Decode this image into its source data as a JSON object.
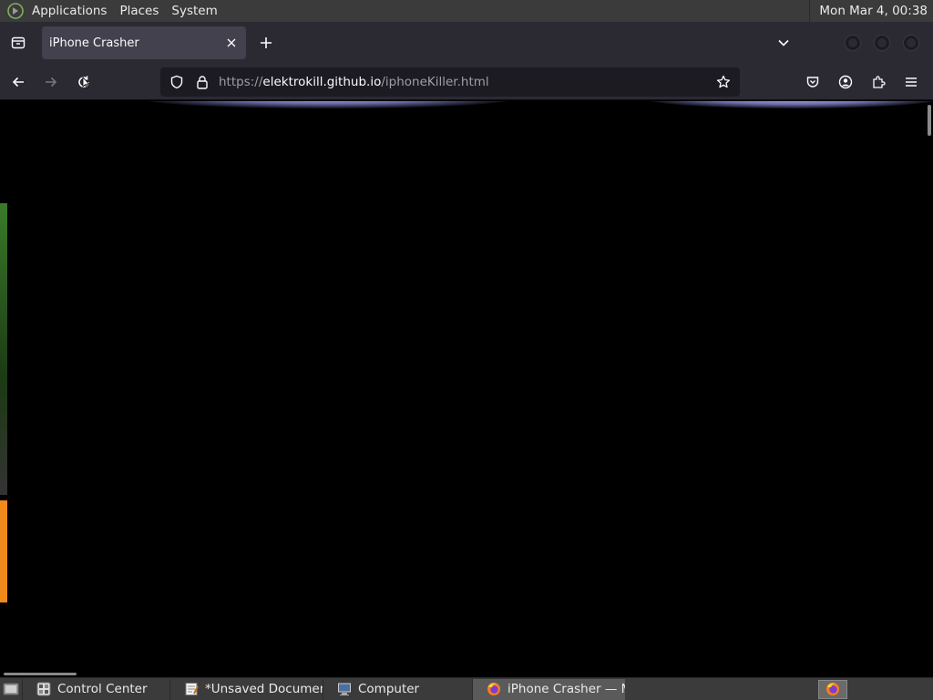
{
  "top_panel": {
    "menus": [
      "Applications",
      "Places",
      "System"
    ],
    "clock": "Mon Mar  4, 00:38"
  },
  "browser": {
    "tab": {
      "title": "iPhone Crasher"
    },
    "url": {
      "scheme": "https://",
      "host": "elektrokill.github.io",
      "path": "/iphoneKiller.html"
    }
  },
  "taskbar": {
    "tasks": [
      {
        "label": "Control Center",
        "icon": "control-center-icon"
      },
      {
        "label": "*Unsaved Documen…",
        "icon": "text-editor-icon"
      },
      {
        "label": "Computer",
        "icon": "computer-icon"
      },
      {
        "label": "iPhone Crasher — M…",
        "icon": "firefox-icon",
        "active": true
      }
    ]
  },
  "colors": {
    "panel": "#3b3b3b",
    "toolbar": "#2b2a33",
    "urlbar": "#1c1b22",
    "page_background": "#000000",
    "edge_orange": "#f08a1a",
    "edge_green": "#3a7a2a"
  }
}
